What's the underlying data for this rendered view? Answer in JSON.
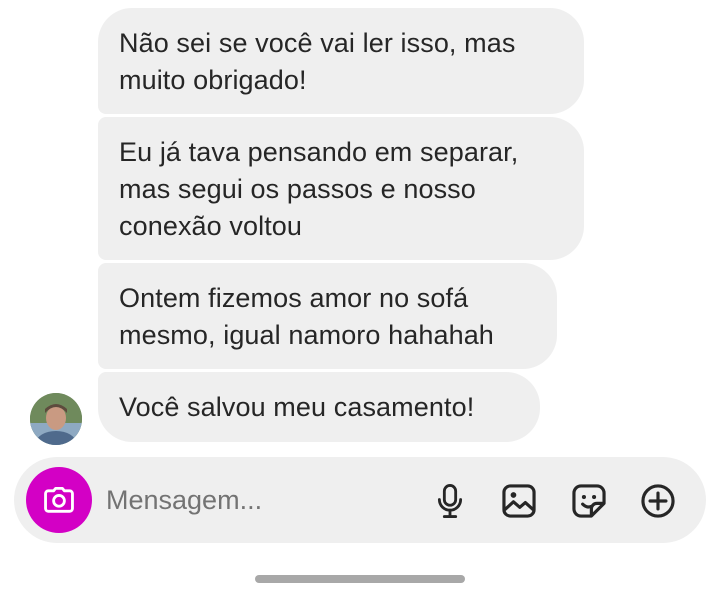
{
  "messages": [
    {
      "text": "Não sei se você vai ler isso, mas\nmuito obrigado!"
    },
    {
      "text": "Eu já tava pensando em separar,\nmas segui os passos e nosso\nconexão voltou"
    },
    {
      "text": "Ontem fizemos amor no sofá\nmesmo, igual namoro hahahah"
    },
    {
      "text": "Você salvou meu casamento!"
    }
  ],
  "composer": {
    "placeholder": "Mensagem...",
    "icons": [
      "camera-icon",
      "microphone-icon",
      "gallery-icon",
      "sticker-icon",
      "plus-circle-icon"
    ],
    "camera_button_color": "#d300c5"
  },
  "colors": {
    "bubble_background": "#efefef",
    "text": "#262626",
    "composer_background": "#efefef"
  }
}
